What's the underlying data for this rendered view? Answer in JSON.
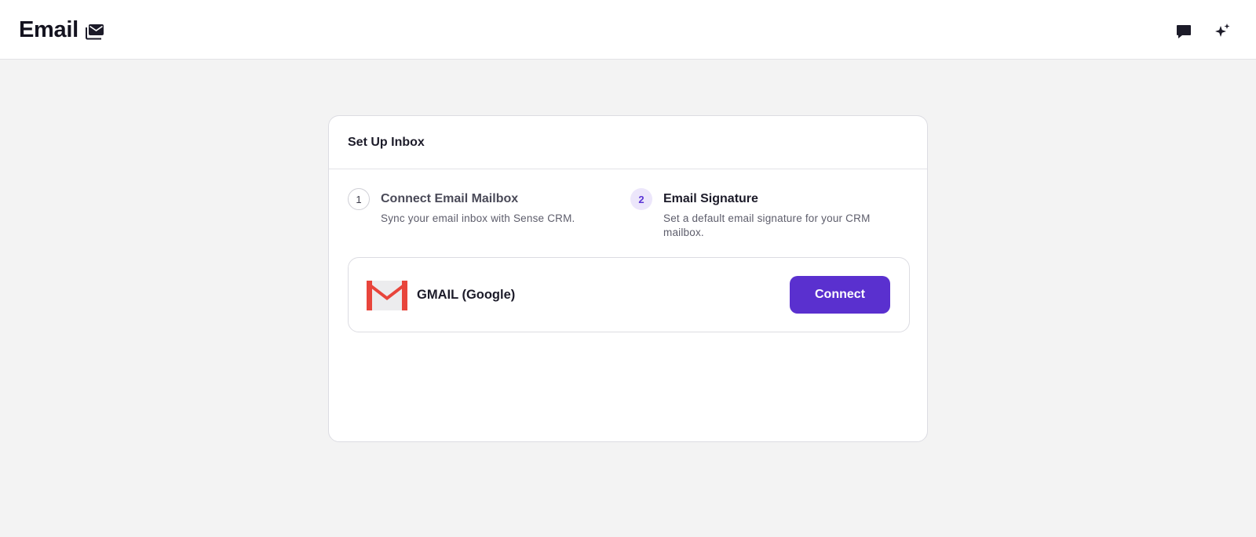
{
  "header": {
    "title": "Email",
    "title_icon": "envelope-stack-icon",
    "actions": [
      {
        "icon": "chat-bubble-icon"
      },
      {
        "icon": "sparkles-ai-icon"
      }
    ]
  },
  "setup": {
    "title": "Set Up Inbox",
    "steps": [
      {
        "number": "1",
        "title": "Connect Email Mailbox",
        "description": "Sync your email inbox with Sense CRM.",
        "active": false
      },
      {
        "number": "2",
        "title": "Email Signature",
        "description": "Set a default email signature for your CRM mailbox.",
        "active": true
      }
    ],
    "provider": {
      "icon": "gmail-icon",
      "name": "GMAIL (Google)",
      "button_label": "Connect"
    }
  },
  "colors": {
    "accent": "#5a30cf",
    "active_step_bg": "#ece6fb",
    "page_bg": "#f3f3f3",
    "gmail_red": "#e8453c"
  }
}
